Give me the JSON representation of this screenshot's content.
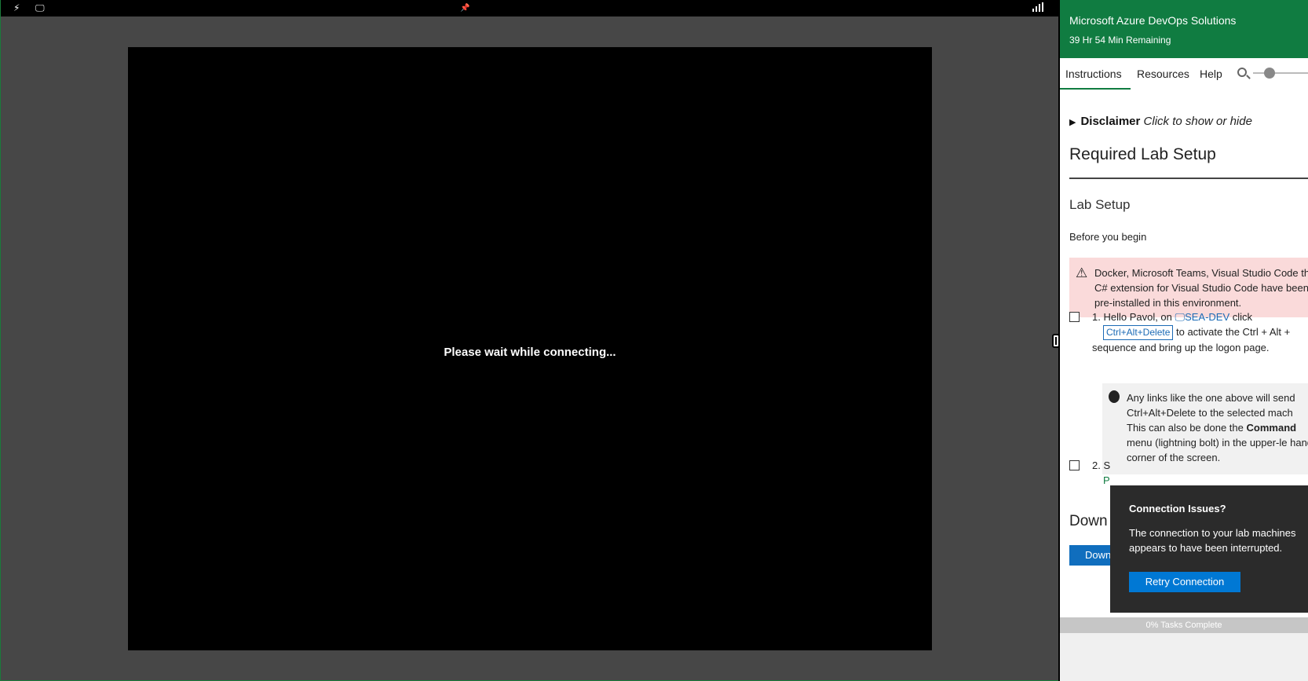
{
  "remote": {
    "toolbar_icons": [
      "lightning-icon",
      "monitor-icon",
      "pin-icon",
      "signal-icon"
    ],
    "status_message": "Please wait while connecting..."
  },
  "panel": {
    "title": "Microsoft Azure DevOps Solutions",
    "time_remaining": "39 Hr 54 Min Remaining",
    "tabs": [
      {
        "label": "Instructions"
      },
      {
        "label": "Resources"
      },
      {
        "label": "Help"
      }
    ],
    "disclaimer": {
      "label": "Disclaimer",
      "hint": "Click to show or hide"
    },
    "heading": "Required Lab Setup",
    "subheading": "Lab Setup",
    "intro": "Before you begin",
    "alert_text": "Docker, Microsoft Teams, Visual Studio Code the C# extension for Visual Studio Code have been pre-installed in this environment.",
    "task1": {
      "prefix": "1. Hello Pavol, on",
      "machine": "SEA-DEV",
      "after_machine": "click",
      "key_button": "Ctrl+Alt+Delete",
      "suffix": "to activate the Ctrl + Alt + sequence and bring up the logon page."
    },
    "tip": {
      "part1": "Any links like the one above will send Ctrl+Alt+Delete to the selected mach This can also be done the",
      "bold": "Command",
      "part2": "menu (lightning bolt) in the upper-le hand corner of the screen."
    },
    "task2_prefix": "2. S",
    "task2_line2": "P",
    "download_heading": "Down",
    "download_button": "Down",
    "progress": "0% Tasks Complete"
  },
  "popup": {
    "title": "Connection Issues?",
    "message": "The connection to your lab machines appears to have been interrupted.",
    "button": "Retry Connection"
  },
  "colors": {
    "brand_green": "#107c41",
    "link_blue": "#1b6ab5",
    "button_blue": "#0078d4",
    "alert_bg": "#fadada"
  }
}
